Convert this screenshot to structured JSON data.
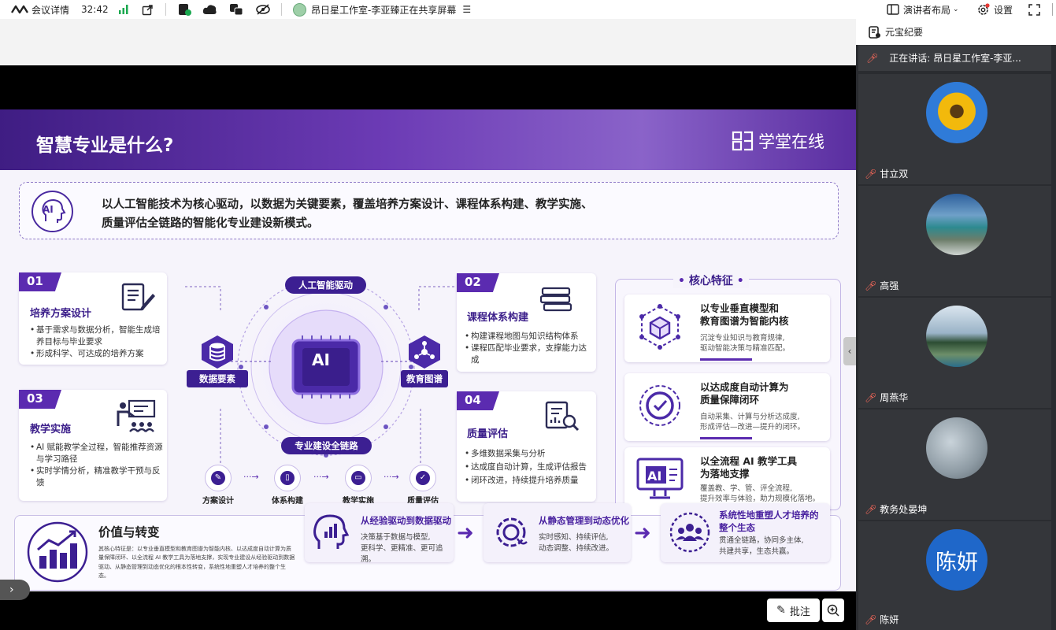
{
  "topbar": {
    "meeting_info": "会议详情",
    "timer": "32:42",
    "share_title": "昂日星工作室-李亚臻正在共享屏幕",
    "layout_label": "演讲者布局",
    "settings_label": "设置"
  },
  "side_label": "元宝纪要",
  "speaking": "正在讲话:  昂日星工作室-李亚...",
  "participants": [
    {
      "name": "甘立双"
    },
    {
      "name": "高强"
    },
    {
      "name": "周燕华"
    },
    {
      "name": "教务处晏坤"
    },
    {
      "name": "陈妍",
      "avatar_text": "陈妍"
    }
  ],
  "slide": {
    "title": "智慧专业是什么?",
    "logo_text": "学堂在线",
    "intro_line1": "以人工智能技术为核心驱动，以数据为关键要素，覆盖培养方案设计、课程体系构建、教学实施、",
    "intro_line2": "质量评估全链路的智能化专业建设新模式。",
    "ai_badge": "AI",
    "ai_chip": "AI",
    "center_top_label": "人工智能驱动",
    "center_bottom_label": "专业建设全链路",
    "data_elem": "数据要素",
    "edu_graph": "教育图谱",
    "cards": [
      {
        "num": "01",
        "title": "培养方案设计",
        "items": [
          "基于需求与数据分析，智能生成培养目标与毕业要求",
          "形成科学、可达成的培养方案"
        ]
      },
      {
        "num": "02",
        "title": "课程体系构建",
        "items": [
          "构建课程地图与知识结构体系",
          "课程匹配毕业要求，支撑能力达成"
        ]
      },
      {
        "num": "03",
        "title": "教学实施",
        "items": [
          "AI 赋能教学全过程，智能推荐资源与学习路径",
          "实时学情分析，精准教学干预与反馈"
        ]
      },
      {
        "num": "04",
        "title": "质量评估",
        "items": [
          "多维数据采集与分析",
          "达成度自动计算，生成评估报告",
          "闭环改进，持续提升培养质量"
        ]
      }
    ],
    "chain": [
      "方案设计",
      "体系构建",
      "教学实施",
      "质量评估"
    ],
    "core_title": "核心特征",
    "features": [
      {
        "title1": "以专业垂直模型和",
        "title2": "教育图谱为智能内核",
        "desc1": "沉淀专业知识与教育规律,",
        "desc2": "驱动智能决策与精准匹配。"
      },
      {
        "title1": "以达成度自动计算为",
        "title2": "质量保障闭环",
        "desc1": "自动采集、计算与分析达成度,",
        "desc2": "形成评估—改进—提升的闭环。"
      },
      {
        "title1": "以全流程 AI 教学工具",
        "title2": "为落地支撑",
        "desc1": "覆盖教、学、管、评全流程,",
        "desc2": "提升效率与体验，助力规模化落地。"
      }
    ],
    "value_title": "价值与转变",
    "value_desc": "其核心特征是：以专业垂直模型和教育图谱为智能内核、以达成度自动计算为质量保障闭环、以全流程 AI 教学工具为落地支撑，实现专业建设从经验驱动到数据驱动、从静态管理到动态优化的根本性转变，系统性地重塑人才培养的整个生态。",
    "values": [
      {
        "title": "从经验驱动到数据驱动",
        "desc1": "决策基于数据与模型,",
        "desc2": "更科学、更精准、更可追溯。"
      },
      {
        "title": "从静态管理到动态优化",
        "desc1": "实时感知、持续评估,",
        "desc2": "动态调整、持续改进。"
      },
      {
        "title1": "系统性地重塑人才培养的",
        "title2": "整个生态",
        "desc1": "贯通全链路，协同多主体,",
        "desc2": "共建共享，生态共赢。"
      }
    ]
  },
  "bottom": {
    "annotate": "批注"
  },
  "colors": {
    "primary": "#5b2bb0",
    "dark": "#3b1e8a",
    "panel": "#2a2c30",
    "avatar_blue": "#1f67c9"
  }
}
